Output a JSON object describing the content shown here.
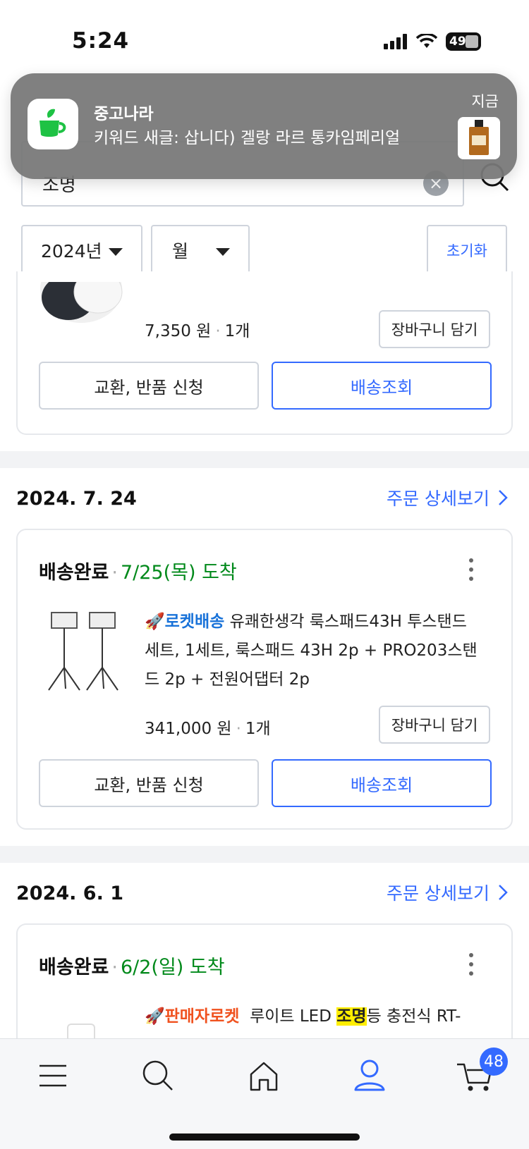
{
  "status_bar": {
    "time": "5:24",
    "battery": "49"
  },
  "notification": {
    "app_name": "중고나라",
    "body": "키워드 새글: 삽니다) 겔랑 라르 통카임페리얼",
    "time": "지금"
  },
  "search": {
    "query": "조명"
  },
  "filters": {
    "year": "2024년",
    "month": "월",
    "reset_label": "초기화"
  },
  "orders": [
    {
      "price": "7,350 원",
      "quantity": "1개",
      "cart_label": "장바구니 담기",
      "exchange_label": "교환, 반품 신청",
      "track_label": "배송조회"
    },
    {
      "date": "2024. 7. 24",
      "detail_link": "주문 상세보기",
      "status": "배송완료",
      "arrival": "7/25(목) 도착",
      "badge": "로켓배송",
      "title": "유쾌한생각 룩스패드43H 투스탠드 세트, 1세트, 룩스패드 43H 2p + PRO203스탠드 2p + 전원어댑터 2p",
      "price": "341,000 원",
      "quantity": "1개",
      "cart_label": "장바구니 담기",
      "exchange_label": "교환, 반품 신청",
      "track_label": "배송조회"
    },
    {
      "date": "2024. 6. 1",
      "detail_link": "주문 상세보기",
      "status": "배송완료",
      "arrival": "6/2(일) 도착",
      "badge": "판매자로켓",
      "title_pre": "루이트 LED ",
      "title_highlight": "조명",
      "title_post": "등 충전식 RT-"
    }
  ],
  "bottom_nav": {
    "items": [
      "menu-icon",
      "search-icon",
      "home-icon",
      "profile-icon",
      "cart-icon"
    ],
    "cart_count": "48"
  },
  "colors": {
    "accent": "#346aff",
    "arrival": "#00891a",
    "rocket": "#1a73d9",
    "seller_rocket": "#f0521f"
  }
}
